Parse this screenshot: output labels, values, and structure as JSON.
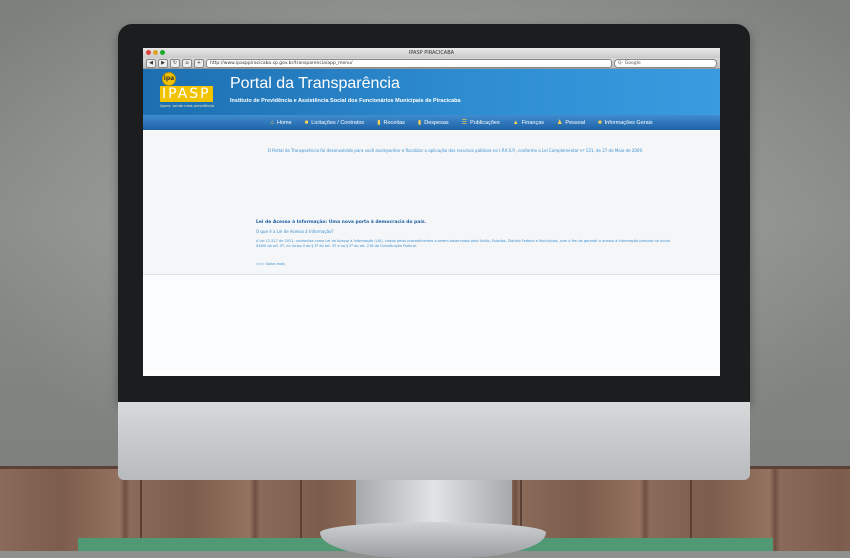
{
  "browser": {
    "window_title": "IPASP PIRACICABA",
    "url": "http://www.ipasppiracicaba.sp.gov.br/transparencia/app_menu/",
    "search_placeholder": "Q- Google",
    "back_label": "◀",
    "forward_label": "▶",
    "reload_label": "↻",
    "home_label": "⌂",
    "add_label": "+"
  },
  "site": {
    "logo_text": "IPASP",
    "logo_badge": "ipa",
    "logo_tagline": "Agora, sendo mais previdência",
    "title": "Portal da Transparência",
    "subtitle": "Instituto de Previdência e Assistência Social dos Funcionários Municipais de Piracicaba"
  },
  "nav": [
    {
      "icon": "home-icon",
      "glyph": "⌂",
      "label": "Home"
    },
    {
      "icon": "folder-icon",
      "glyph": "■",
      "label": "Licitações / Contratos"
    },
    {
      "icon": "chart-icon",
      "glyph": "▮",
      "label": "Receitas"
    },
    {
      "icon": "chart-icon",
      "glyph": "▮",
      "label": "Despesas"
    },
    {
      "icon": "document-icon",
      "glyph": "☰",
      "label": "Publicações"
    },
    {
      "icon": "finance-icon",
      "glyph": "▲",
      "label": "Finanças"
    },
    {
      "icon": "people-icon",
      "glyph": "♟",
      "label": "Pessoal"
    },
    {
      "icon": "info-icon",
      "glyph": "■",
      "label": "Informações Gerais"
    }
  ],
  "content": {
    "intro": "O Portal da Transparência foi desenvolvido para você acompanhar e fiscalizar a aplicação dos recursos públicos no I.P.A.S.P., conforme a Lei Complementar nº 131, de 27 de Maio de 2009.",
    "lai_title": "Lei de Acesso à Informação: Uma nova porta à democracia do país.",
    "lai_question": "O que é a Lei de Acesso à Informação?",
    "lai_paragraph": "A Lei 12.527 de 2011, conhecida como Lei de Acesso à Informação (LAI), criada pelos procedimentos a serem observados pela União, Estados, Distrito Federal e Municípios, com o fim de garantir o acesso à informação previsto no inciso XXXIII do art. 5º, no inciso II do § 3º do art. 37 e no § 2º do art. 216 da Constituição Federal.",
    "lai_more": ">>> Saiba mais"
  },
  "colors": {
    "header_blue": "#2f8ed2",
    "nav_blue": "#1f62a6",
    "logo_yellow": "#f2c400",
    "link_blue": "#3b8fd0"
  }
}
